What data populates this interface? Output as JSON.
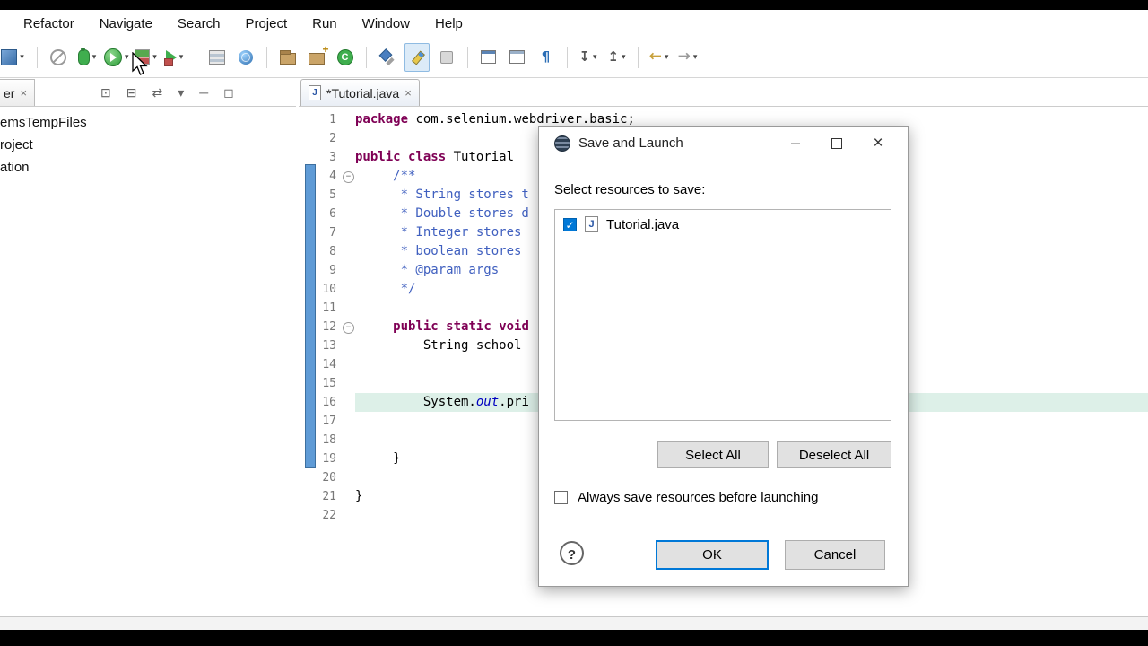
{
  "colors": {
    "accent": "#0078d7",
    "keyword": "#7f0055",
    "javadoc": "#3f5fbf",
    "range_indicator": "#5f9bd6",
    "current_line": "#ddf0e8"
  },
  "menubar": {
    "items": [
      "Refactor",
      "Navigate",
      "Search",
      "Project",
      "Run",
      "Window",
      "Help"
    ]
  },
  "toolbar": {
    "icons": [
      {
        "name": "new-wizard-icon",
        "cls": "ic-new",
        "caret": true
      },
      {
        "sep": true
      },
      {
        "name": "skip-all-breakpoints-icon",
        "cls": "ic-skip"
      },
      {
        "name": "debug-icon",
        "cls": "ic-debug",
        "caret": true
      },
      {
        "name": "run-icon",
        "cls": "ic-run",
        "caret": true
      },
      {
        "name": "coverage-icon",
        "cls": "ic-cov",
        "caret": true
      },
      {
        "name": "run-external-tools-icon",
        "cls": "ic-ext",
        "caret": true
      },
      {
        "sep": true
      },
      {
        "name": "servers-icon",
        "cls": "ic-srv"
      },
      {
        "name": "web-browser-icon",
        "cls": "ic-web"
      },
      {
        "sep": true
      },
      {
        "name": "new-java-package-icon",
        "cls": "ic-pkg"
      },
      {
        "name": "open-type-icon",
        "cls": "ic-pkg2"
      },
      {
        "name": "new-java-class-icon",
        "cls": "ic-cls"
      },
      {
        "sep": true
      },
      {
        "name": "search-icon",
        "cls": "ic-search"
      },
      {
        "name": "mark-occurrences-icon",
        "cls": "ic-mark",
        "active": true
      },
      {
        "name": "last-edit-location-icon",
        "cls": "ic-edit"
      },
      {
        "sep": true
      },
      {
        "name": "link-with-editor-icon",
        "cls": "ic-link"
      },
      {
        "name": "editor-window-icon",
        "cls": "ic-win"
      },
      {
        "name": "show-whitespace-icon",
        "cls": "ic-pilcrow",
        "glyph": "¶"
      },
      {
        "sep": true
      },
      {
        "name": "next-annotation-icon",
        "cls": "ic-next",
        "glyph": "↧",
        "caret": true
      },
      {
        "name": "previous-annotation-icon",
        "cls": "ic-prev",
        "glyph": "↥",
        "caret": true
      },
      {
        "sep": true
      },
      {
        "name": "back-icon",
        "cls": "ic-back",
        "glyph": "←",
        "caret": true
      },
      {
        "name": "forward-icon",
        "cls": "ic-fwd",
        "glyph": "→",
        "caret": true
      }
    ]
  },
  "explorer": {
    "tab_fragment": "er",
    "close_glyph": "×",
    "toolbar_icons": [
      {
        "name": "focus-on-active-task-icon",
        "glyph": "⊡"
      },
      {
        "name": "collapse-all-icon",
        "glyph": "⊟"
      },
      {
        "name": "link-with-editor-icon",
        "glyph": "⇄"
      },
      {
        "name": "view-menu-icon",
        "glyph": "▾"
      },
      {
        "name": "minimize-icon",
        "glyph": "─"
      },
      {
        "name": "maximize-icon",
        "glyph": "◻"
      }
    ],
    "items": [
      "emsTempFiles",
      "roject",
      "ation"
    ]
  },
  "editor": {
    "tab": {
      "label": "*Tutorial.java",
      "file_icon": "J",
      "close_glyph": "×"
    },
    "lines": [
      {
        "n": 1,
        "seg": [
          [
            "kw",
            "package"
          ],
          [
            "pl",
            " com.selenium.webdriver.basic;"
          ]
        ]
      },
      {
        "n": 2,
        "seg": []
      },
      {
        "n": 3,
        "seg": [
          [
            "kw",
            "public"
          ],
          [
            "pl",
            " "
          ],
          [
            "kw",
            "class"
          ],
          [
            "pl",
            " Tutorial"
          ]
        ]
      },
      {
        "n": 4,
        "fold": true,
        "seg": [
          [
            "doc",
            "     /**"
          ]
        ]
      },
      {
        "n": 5,
        "seg": [
          [
            "doc",
            "      * String stores t"
          ]
        ]
      },
      {
        "n": 6,
        "seg": [
          [
            "doc",
            "      * Double stores d"
          ]
        ]
      },
      {
        "n": 7,
        "seg": [
          [
            "doc",
            "      * Integer stores"
          ]
        ]
      },
      {
        "n": 8,
        "seg": [
          [
            "doc",
            "      * boolean stores"
          ]
        ]
      },
      {
        "n": 9,
        "seg": [
          [
            "doc",
            "      * @param args"
          ]
        ]
      },
      {
        "n": 10,
        "seg": [
          [
            "doc",
            "      */"
          ]
        ]
      },
      {
        "n": 11,
        "seg": []
      },
      {
        "n": 12,
        "fold": true,
        "seg": [
          [
            "pl",
            "     "
          ],
          [
            "kw",
            "public"
          ],
          [
            "pl",
            " "
          ],
          [
            "kw",
            "static"
          ],
          [
            "pl",
            " "
          ],
          [
            "kw",
            "void"
          ]
        ]
      },
      {
        "n": 13,
        "seg": [
          [
            "pl",
            "         String school"
          ]
        ]
      },
      {
        "n": 14,
        "seg": []
      },
      {
        "n": 15,
        "seg": []
      },
      {
        "n": 16,
        "hl": true,
        "seg": [
          [
            "pl",
            "         System."
          ],
          [
            "fld",
            "out"
          ],
          [
            "pl",
            ".pri"
          ]
        ]
      },
      {
        "n": 17,
        "seg": []
      },
      {
        "n": 18,
        "seg": []
      },
      {
        "n": 19,
        "seg": [
          [
            "pl",
            "     }"
          ]
        ]
      },
      {
        "n": 20,
        "seg": []
      },
      {
        "n": 21,
        "seg": [
          [
            "pl",
            "}"
          ]
        ]
      },
      {
        "n": 22,
        "seg": []
      }
    ]
  },
  "dialog": {
    "title": "Save and Launch",
    "prompt": "Select resources to save:",
    "resources": [
      {
        "label": "Tutorial.java",
        "checked": true,
        "file_icon": "J"
      }
    ],
    "select_all": "Select All",
    "deselect_all": "Deselect All",
    "always_save": "Always save resources before launching",
    "help": "?",
    "ok": "OK",
    "cancel": "Cancel"
  }
}
